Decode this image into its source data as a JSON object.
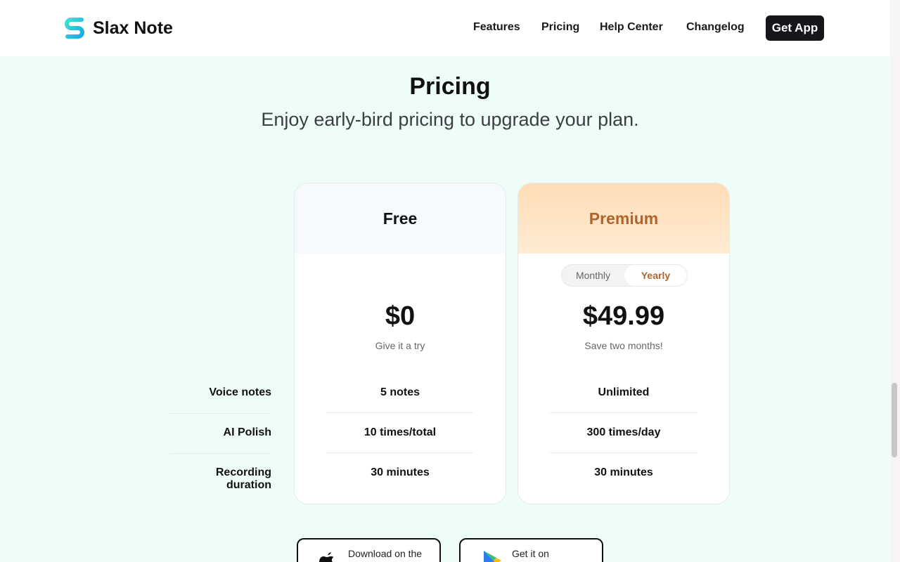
{
  "header": {
    "brand": "Slax Note",
    "nav": [
      "Features",
      "Pricing",
      "Help Center",
      "Changelog"
    ],
    "cta": "Get App"
  },
  "hero": {
    "title": "Pricing",
    "subtitle": "Enjoy early-bird pricing to upgrade your plan."
  },
  "features": [
    "Voice notes",
    "AI Polish",
    "Recording duration"
  ],
  "plans": {
    "free": {
      "name": "Free",
      "price": "$0",
      "note": "Give it a try",
      "values": [
        "5 notes",
        "10 times/total",
        "30 minutes"
      ]
    },
    "premium": {
      "name": "Premium",
      "toggle": {
        "monthly": "Monthly",
        "yearly": "Yearly",
        "selected": "Yearly"
      },
      "price": "$49.99",
      "note": "Save two months!",
      "values": [
        "Unlimited",
        "300 times/day",
        "30 minutes"
      ]
    }
  },
  "stores": {
    "apple": "Download on the",
    "google": "Get it on"
  },
  "colors": {
    "background": "#effdf8",
    "premium_accent": "#b0642a",
    "button_dark": "#15171c"
  }
}
